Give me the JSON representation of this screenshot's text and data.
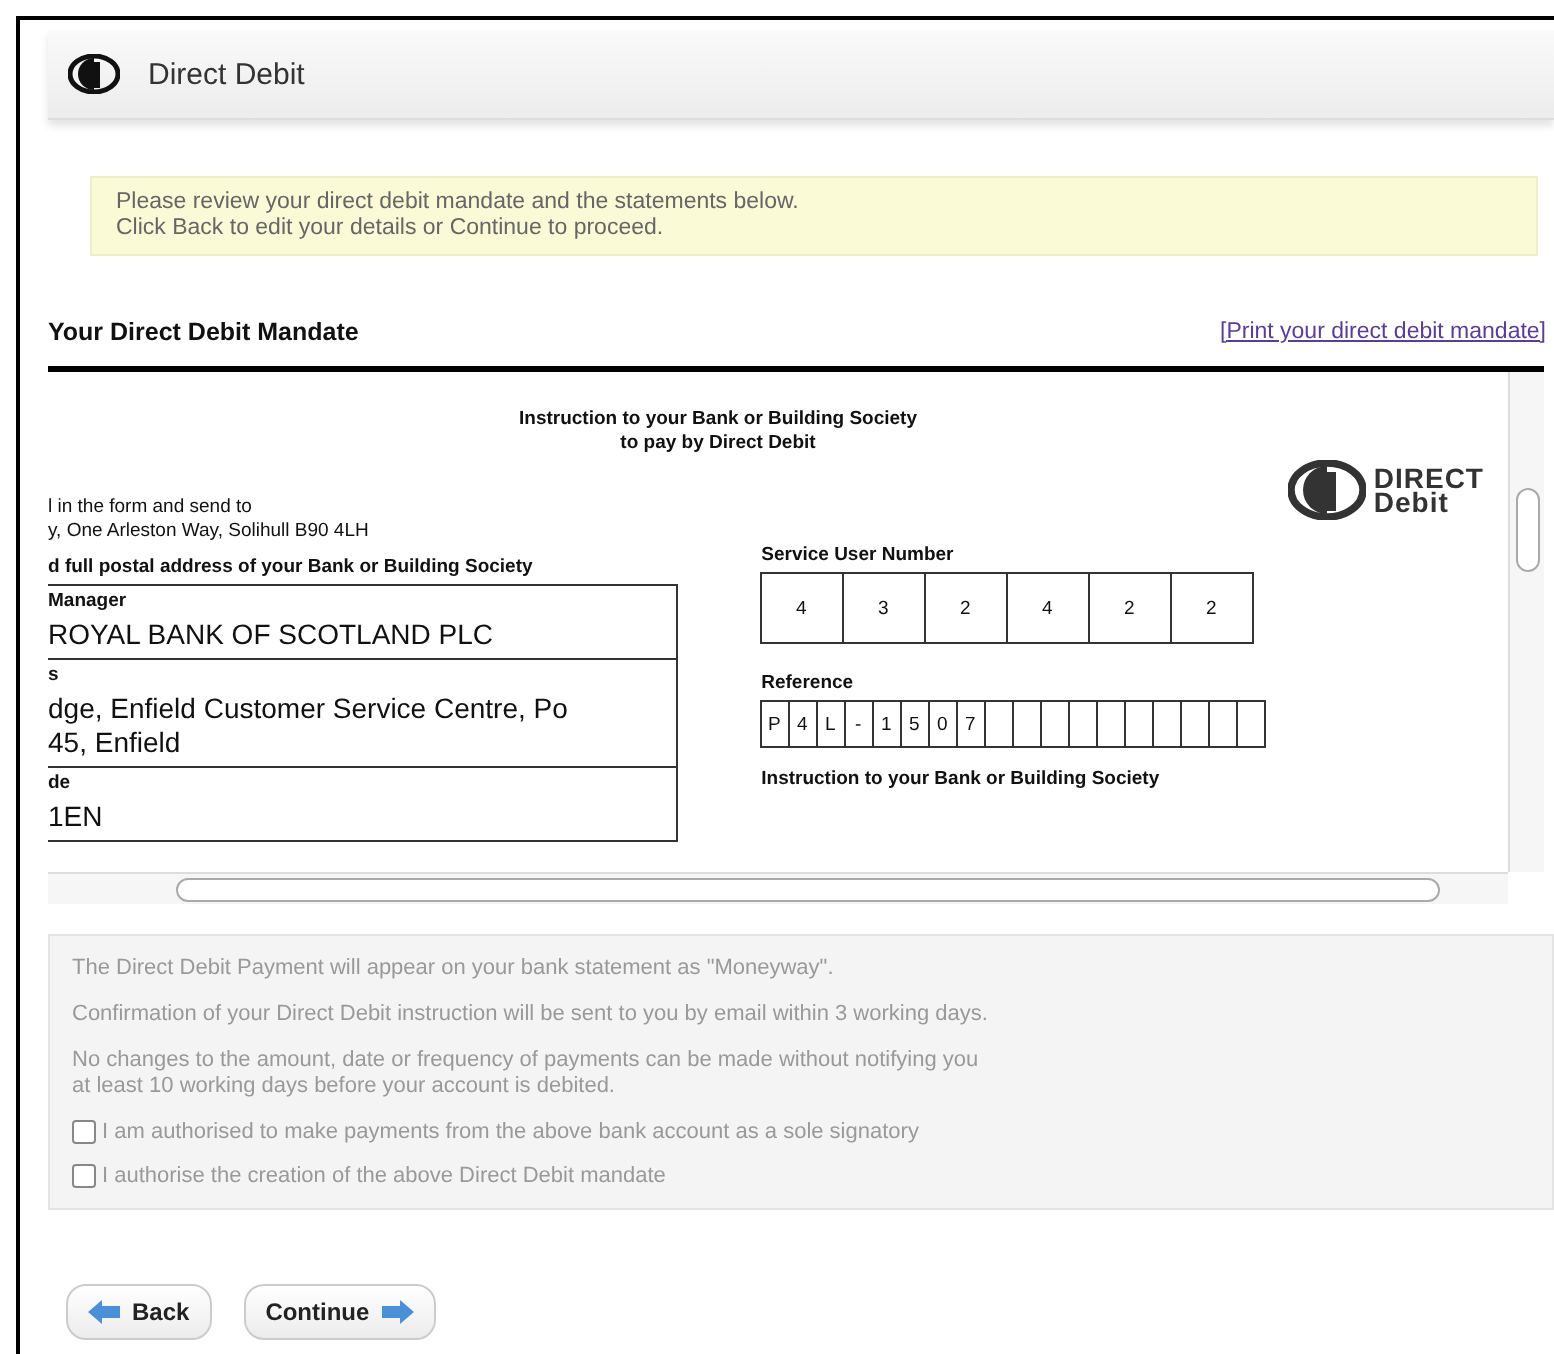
{
  "header": {
    "title": "Direct Debit"
  },
  "notice": [
    "Please review your direct debit mandate and the statements below.",
    "Click Back to edit your details or Continue to proceed."
  ],
  "mandate_section": {
    "heading": "Your Direct Debit Mandate",
    "print_link": "[Print your direct debit mandate]"
  },
  "mandate": {
    "title_lines": [
      "Instruction to your Bank or Building Society",
      "to pay by Direct Debit"
    ],
    "send_to": [
      "l in the form and send to",
      "y, One Arleston Way, Solihull B90 4LH"
    ],
    "logo_text": [
      "DIRECT",
      "Debit"
    ],
    "bank_heading": "d full postal address of your Bank or Building Society",
    "bank_fields": [
      {
        "label": "Manager",
        "value_lines": [
          "ROYAL BANK OF SCOTLAND PLC"
        ]
      },
      {
        "label": "s",
        "value_lines": [
          "dge, Enfield Customer Service Centre, Po",
          "45, Enfield"
        ]
      },
      {
        "label": "de",
        "value_lines": [
          "1EN"
        ]
      }
    ],
    "service_user_number": {
      "label": "Service User Number",
      "digits": [
        "4",
        "3",
        "2",
        "4",
        "2",
        "2"
      ]
    },
    "reference": {
      "label": "Reference",
      "chars": [
        "P",
        "4",
        "L",
        "-",
        "1",
        "5",
        "0",
        "7"
      ]
    },
    "instruction_heading": "Instruction to your Bank or Building Society"
  },
  "statements": [
    "The Direct Debit Payment will appear on your bank statement as \"Moneyway\".",
    "Confirmation of your Direct Debit instruction will be sent to you by email within 3 working days.",
    "No changes to the amount, date or frequency of payments can be made without notifying you\nat least 10 working days before your account is debited."
  ],
  "confirmations": [
    {
      "label": "I am authorised to make payments from the above bank account as a sole signatory",
      "checked": false
    },
    {
      "label": "I authorise the creation of the above Direct Debit mandate",
      "checked": false
    }
  ],
  "buttons": [
    {
      "label": "Back",
      "kind": "back"
    },
    {
      "label": "Continue",
      "kind": "next"
    }
  ]
}
